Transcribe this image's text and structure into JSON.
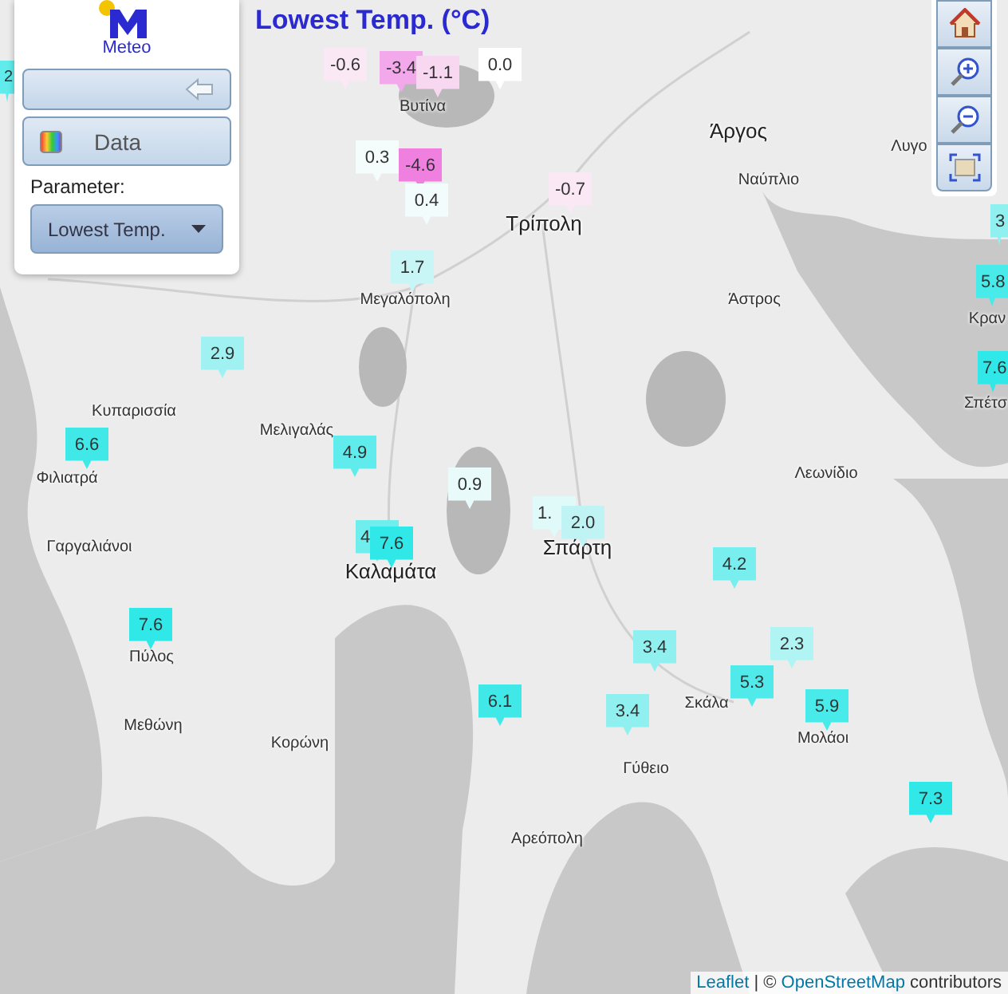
{
  "panel": {
    "logo_text": "Meteo",
    "data_button": "Data",
    "parameter_label": "Parameter:",
    "parameter_select": "Lowest Temp."
  },
  "map": {
    "title": "Lowest Temp. (°C)",
    "places": [
      {
        "name": "Βυτίνα",
        "kind": "town"
      },
      {
        "name": "Τρίπολη",
        "kind": "city"
      },
      {
        "name": "Άργος",
        "kind": "city"
      },
      {
        "name": "Ναύπλιο",
        "kind": "town"
      },
      {
        "name": "Λυγο",
        "kind": "town"
      },
      {
        "name": "Άστρος",
        "kind": "town"
      },
      {
        "name": "Μεγαλόπολη",
        "kind": "town"
      },
      {
        "name": "Κυπαρισσία",
        "kind": "town"
      },
      {
        "name": "Μελιγαλάς",
        "kind": "town"
      },
      {
        "name": "Φιλιατρά",
        "kind": "town"
      },
      {
        "name": "Λεωνίδιο",
        "kind": "town"
      },
      {
        "name": "Γαργαλιάνοι",
        "kind": "town"
      },
      {
        "name": "Καλαμάτα",
        "kind": "city"
      },
      {
        "name": "Σπάρτη",
        "kind": "city"
      },
      {
        "name": "Πύλος",
        "kind": "town"
      },
      {
        "name": "Μεθώνη",
        "kind": "town"
      },
      {
        "name": "Κορώνη",
        "kind": "town"
      },
      {
        "name": "Σκάλα",
        "kind": "town"
      },
      {
        "name": "Μολάοι",
        "kind": "town"
      },
      {
        "name": "Γύθειο",
        "kind": "town"
      },
      {
        "name": "Αρεόπολη",
        "kind": "town"
      },
      {
        "name": "Κραν",
        "kind": "town"
      },
      {
        "name": "Σπέτσ",
        "kind": "town"
      }
    ],
    "markers": [
      {
        "value": "2",
        "color": "#60ecec"
      },
      {
        "value": "-0.6",
        "color": "#fae8f4"
      },
      {
        "value": "-3.4",
        "color": "#f2a8ea"
      },
      {
        "value": "-1.1",
        "color": "#f8d8f0"
      },
      {
        "value": "0.0",
        "color": "#ffffff"
      },
      {
        "value": "0.3",
        "color": "#f4fcfc"
      },
      {
        "value": "-4.6",
        "color": "#f080e0"
      },
      {
        "value": "0.4",
        "color": "#f2fcfc"
      },
      {
        "value": "-0.7",
        "color": "#fae8f4"
      },
      {
        "value": "1.7",
        "color": "#c8f6f6"
      },
      {
        "value": "3",
        "color": "#90f0f0"
      },
      {
        "value": "5.8",
        "color": "#48eaea"
      },
      {
        "value": "7.6",
        "color": "#30e8e8"
      },
      {
        "value": "2.9",
        "color": "#a0f2f2"
      },
      {
        "value": "6.6",
        "color": "#40e8e8"
      },
      {
        "value": "4.9",
        "color": "#60ecec"
      },
      {
        "value": "0.9",
        "color": "#e8fafa"
      },
      {
        "value": "4",
        "color": "#70eeee"
      },
      {
        "value": "7.6",
        "color": "#30e8e8"
      },
      {
        "value": "7.6",
        "color": "#30e8e8"
      },
      {
        "value": "1.",
        "color": "#e0fafa"
      },
      {
        "value": "2.0",
        "color": "#c0f4f4"
      },
      {
        "value": "4.2",
        "color": "#78eeee"
      },
      {
        "value": "3.4",
        "color": "#90f0f0"
      },
      {
        "value": "2.3",
        "color": "#b0f4f4"
      },
      {
        "value": "6.1",
        "color": "#40e8e8"
      },
      {
        "value": "5.3",
        "color": "#50eaea"
      },
      {
        "value": "3.4",
        "color": "#90f0f0"
      },
      {
        "value": "5.9",
        "color": "#48eaea"
      },
      {
        "value": "7.3",
        "color": "#30e8e8"
      }
    ],
    "attribution": {
      "leaflet": "Leaflet",
      "separator": "| ©",
      "osm": "OpenStreetMap",
      "suffix": "contributors"
    }
  }
}
